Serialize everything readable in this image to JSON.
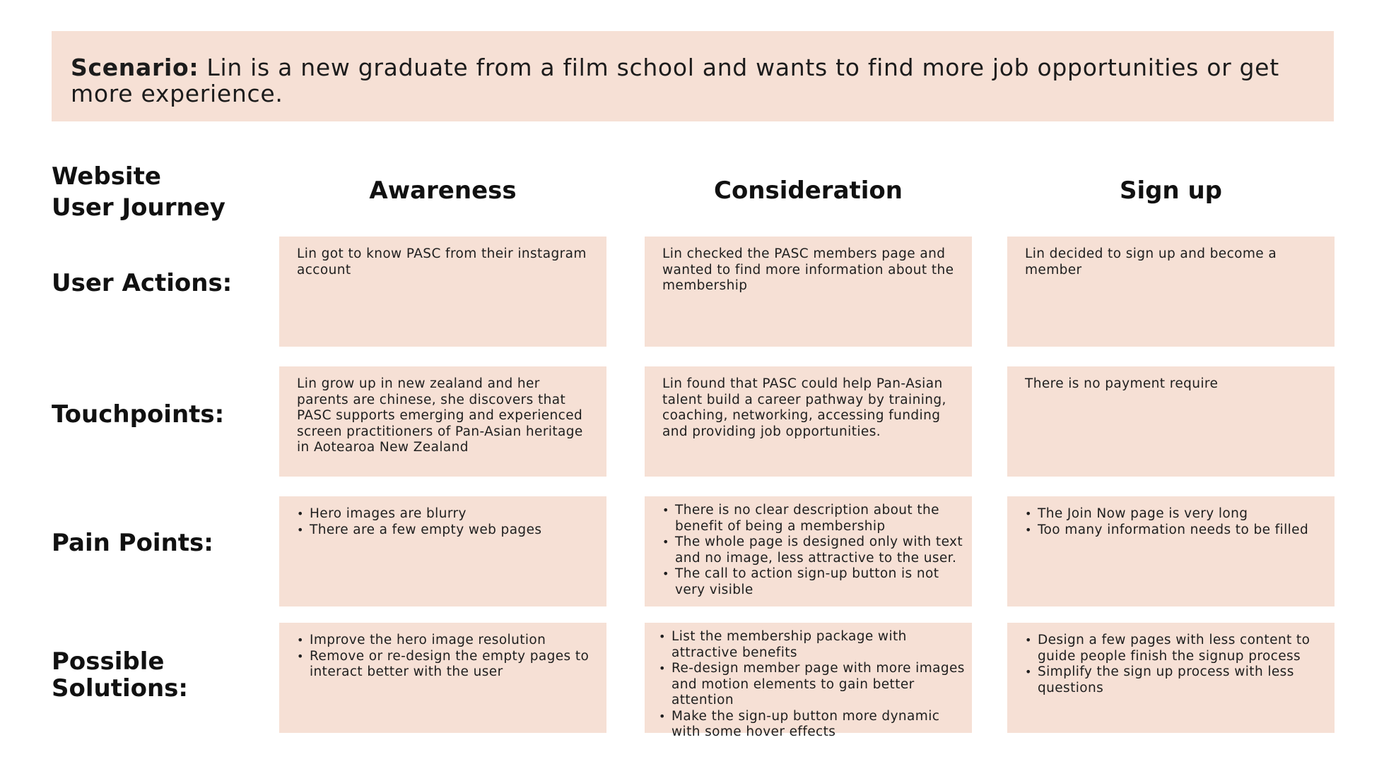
{
  "scenario": {
    "label": "Scenario:",
    "text": " Lin is a new graduate from a film school and wants to find more job opportunities or get more experience."
  },
  "journey": {
    "title_line1": "Website",
    "title_line2": "User Journey",
    "stages": [
      "Awareness",
      "Consideration",
      "Sign up"
    ],
    "rows": [
      {
        "label": "User Actions:",
        "cells": [
          {
            "text": "Lin got to know PASC from their instagram account"
          },
          {
            "text": "Lin checked the PASC members page and wanted to find more information about the membership"
          },
          {
            "text": "Lin decided to sign up and become a member"
          }
        ]
      },
      {
        "label": "Touchpoints:",
        "cells": [
          {
            "text": "Lin grow up in new zealand and her parents are chinese,  she discovers that PASC supports emerging and experienced screen practitioners of Pan-Asian heritage in Aotearoa New Zealand"
          },
          {
            "text": "Lin found that PASC could help Pan-Asian talent build a career pathway by training, coaching, networking, accessing funding and providing job opportunities."
          },
          {
            "text": "There is no payment require"
          }
        ]
      },
      {
        "label": "Pain Points:",
        "cells": [
          {
            "bullets": [
              "Hero images are blurry",
              "There are a few empty web pages"
            ]
          },
          {
            "bullets": [
              "There is no clear description about the benefit of being a membership",
              "The whole page is designed only with text and no image, less attractive to the user.",
              "The call to action sign-up button is not very visible"
            ]
          },
          {
            "bullets": [
              "The Join Now page is very long",
              "Too many information needs to be filled"
            ]
          }
        ]
      },
      {
        "label_line1": "Possible",
        "label_line2": "Solutions:",
        "cells": [
          {
            "bullets": [
              "Improve the hero image resolution",
              "Remove or re-design the empty pages to interact better with the user"
            ]
          },
          {
            "bullets": [
              "List the membership package with attractive benefits",
              "Re-design member page with more images and motion elements to gain better attention",
              "Make the sign-up button more dynamic with some hover effects"
            ]
          },
          {
            "bullets": [
              "Design a few pages with less content to guide people finish the signup process",
              "Simplify the sign up process with less questions"
            ]
          }
        ]
      }
    ]
  }
}
